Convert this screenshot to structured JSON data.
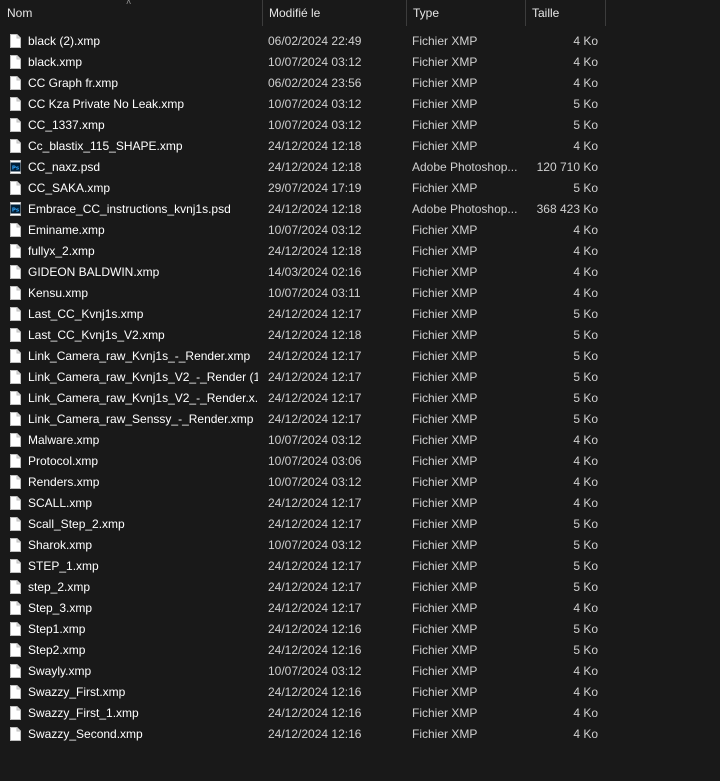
{
  "columns": {
    "name": "Nom",
    "modified": "Modifié le",
    "type": "Type",
    "size": "Taille"
  },
  "colors": {
    "background": "#191919",
    "psd_icon": "#2f7fd1",
    "doc_icon": "#ffffff"
  },
  "files": [
    {
      "name": "black (2).xmp",
      "date": "06/02/2024 22:49",
      "type": "Fichier XMP",
      "size": "4 Ko",
      "icon": "document-icon"
    },
    {
      "name": "black.xmp",
      "date": "10/07/2024 03:12",
      "type": "Fichier XMP",
      "size": "4 Ko",
      "icon": "document-icon"
    },
    {
      "name": "CC Graph fr.xmp",
      "date": "06/02/2024 23:56",
      "type": "Fichier XMP",
      "size": "4 Ko",
      "icon": "document-icon"
    },
    {
      "name": "CC Kza Private No Leak.xmp",
      "date": "10/07/2024 03:12",
      "type": "Fichier XMP",
      "size": "5 Ko",
      "icon": "document-icon"
    },
    {
      "name": "CC_1337.xmp",
      "date": "10/07/2024 03:12",
      "type": "Fichier XMP",
      "size": "5 Ko",
      "icon": "document-icon"
    },
    {
      "name": "Cc_blastix_115_SHAPE.xmp",
      "date": "24/12/2024 12:18",
      "type": "Fichier XMP",
      "size": "4 Ko",
      "icon": "document-icon"
    },
    {
      "name": "CC_naxz.psd",
      "date": "24/12/2024 12:18",
      "type": "Adobe Photoshop...",
      "size": "120 710 Ko",
      "icon": "photoshop-icon"
    },
    {
      "name": "CC_SAKA.xmp",
      "date": "29/07/2024 17:19",
      "type": "Fichier XMP",
      "size": "5 Ko",
      "icon": "document-icon"
    },
    {
      "name": "Embrace_CC_instructions_kvnj1s.psd",
      "date": "24/12/2024 12:18",
      "type": "Adobe Photoshop...",
      "size": "368 423 Ko",
      "icon": "photoshop-icon"
    },
    {
      "name": "Eminame.xmp",
      "date": "10/07/2024 03:12",
      "type": "Fichier XMP",
      "size": "4 Ko",
      "icon": "document-icon"
    },
    {
      "name": "fullyx_2.xmp",
      "date": "24/12/2024 12:18",
      "type": "Fichier XMP",
      "size": "4 Ko",
      "icon": "document-icon"
    },
    {
      "name": "GIDEON BALDWIN.xmp",
      "date": "14/03/2024 02:16",
      "type": "Fichier XMP",
      "size": "4 Ko",
      "icon": "document-icon"
    },
    {
      "name": "Kensu.xmp",
      "date": "10/07/2024 03:11",
      "type": "Fichier XMP",
      "size": "4 Ko",
      "icon": "document-icon"
    },
    {
      "name": "Last_CC_Kvnj1s.xmp",
      "date": "24/12/2024 12:17",
      "type": "Fichier XMP",
      "size": "5 Ko",
      "icon": "document-icon"
    },
    {
      "name": "Last_CC_Kvnj1s_V2.xmp",
      "date": "24/12/2024 12:18",
      "type": "Fichier XMP",
      "size": "5 Ko",
      "icon": "document-icon"
    },
    {
      "name": "Link_Camera_raw_Kvnj1s_-_Render.xmp",
      "date": "24/12/2024 12:17",
      "type": "Fichier XMP",
      "size": "5 Ko",
      "icon": "document-icon"
    },
    {
      "name": "Link_Camera_raw_Kvnj1s_V2_-_Render (1...",
      "date": "24/12/2024 12:17",
      "type": "Fichier XMP",
      "size": "5 Ko",
      "icon": "document-icon"
    },
    {
      "name": "Link_Camera_raw_Kvnj1s_V2_-_Render.x...",
      "date": "24/12/2024 12:17",
      "type": "Fichier XMP",
      "size": "5 Ko",
      "icon": "document-icon"
    },
    {
      "name": "Link_Camera_raw_Senssy_-_Render.xmp",
      "date": "24/12/2024 12:17",
      "type": "Fichier XMP",
      "size": "5 Ko",
      "icon": "document-icon"
    },
    {
      "name": "Malware.xmp",
      "date": "10/07/2024 03:12",
      "type": "Fichier XMP",
      "size": "4 Ko",
      "icon": "document-icon"
    },
    {
      "name": "Protocol.xmp",
      "date": "10/07/2024 03:06",
      "type": "Fichier XMP",
      "size": "4 Ko",
      "icon": "document-icon"
    },
    {
      "name": "Renders.xmp",
      "date": "10/07/2024 03:12",
      "type": "Fichier XMP",
      "size": "4 Ko",
      "icon": "document-icon"
    },
    {
      "name": "SCALL.xmp",
      "date": "24/12/2024 12:17",
      "type": "Fichier XMP",
      "size": "4 Ko",
      "icon": "document-icon"
    },
    {
      "name": "Scall_Step_2.xmp",
      "date": "24/12/2024 12:17",
      "type": "Fichier XMP",
      "size": "5 Ko",
      "icon": "document-icon"
    },
    {
      "name": "Sharok.xmp",
      "date": "10/07/2024 03:12",
      "type": "Fichier XMP",
      "size": "5 Ko",
      "icon": "document-icon"
    },
    {
      "name": "STEP_1.xmp",
      "date": "24/12/2024 12:17",
      "type": "Fichier XMP",
      "size": "5 Ko",
      "icon": "document-icon"
    },
    {
      "name": "step_2.xmp",
      "date": "24/12/2024 12:17",
      "type": "Fichier XMP",
      "size": "5 Ko",
      "icon": "document-icon"
    },
    {
      "name": "Step_3.xmp",
      "date": "24/12/2024 12:17",
      "type": "Fichier XMP",
      "size": "4 Ko",
      "icon": "document-icon"
    },
    {
      "name": "Step1.xmp",
      "date": "24/12/2024 12:16",
      "type": "Fichier XMP",
      "size": "5 Ko",
      "icon": "document-icon"
    },
    {
      "name": "Step2.xmp",
      "date": "24/12/2024 12:16",
      "type": "Fichier XMP",
      "size": "5 Ko",
      "icon": "document-icon"
    },
    {
      "name": "Swayly.xmp",
      "date": "10/07/2024 03:12",
      "type": "Fichier XMP",
      "size": "4 Ko",
      "icon": "document-icon"
    },
    {
      "name": "Swazzy_First.xmp",
      "date": "24/12/2024 12:16",
      "type": "Fichier XMP",
      "size": "4 Ko",
      "icon": "document-icon"
    },
    {
      "name": "Swazzy_First_1.xmp",
      "date": "24/12/2024 12:16",
      "type": "Fichier XMP",
      "size": "4 Ko",
      "icon": "document-icon"
    },
    {
      "name": "Swazzy_Second.xmp",
      "date": "24/12/2024 12:16",
      "type": "Fichier XMP",
      "size": "4 Ko",
      "icon": "document-icon"
    }
  ]
}
